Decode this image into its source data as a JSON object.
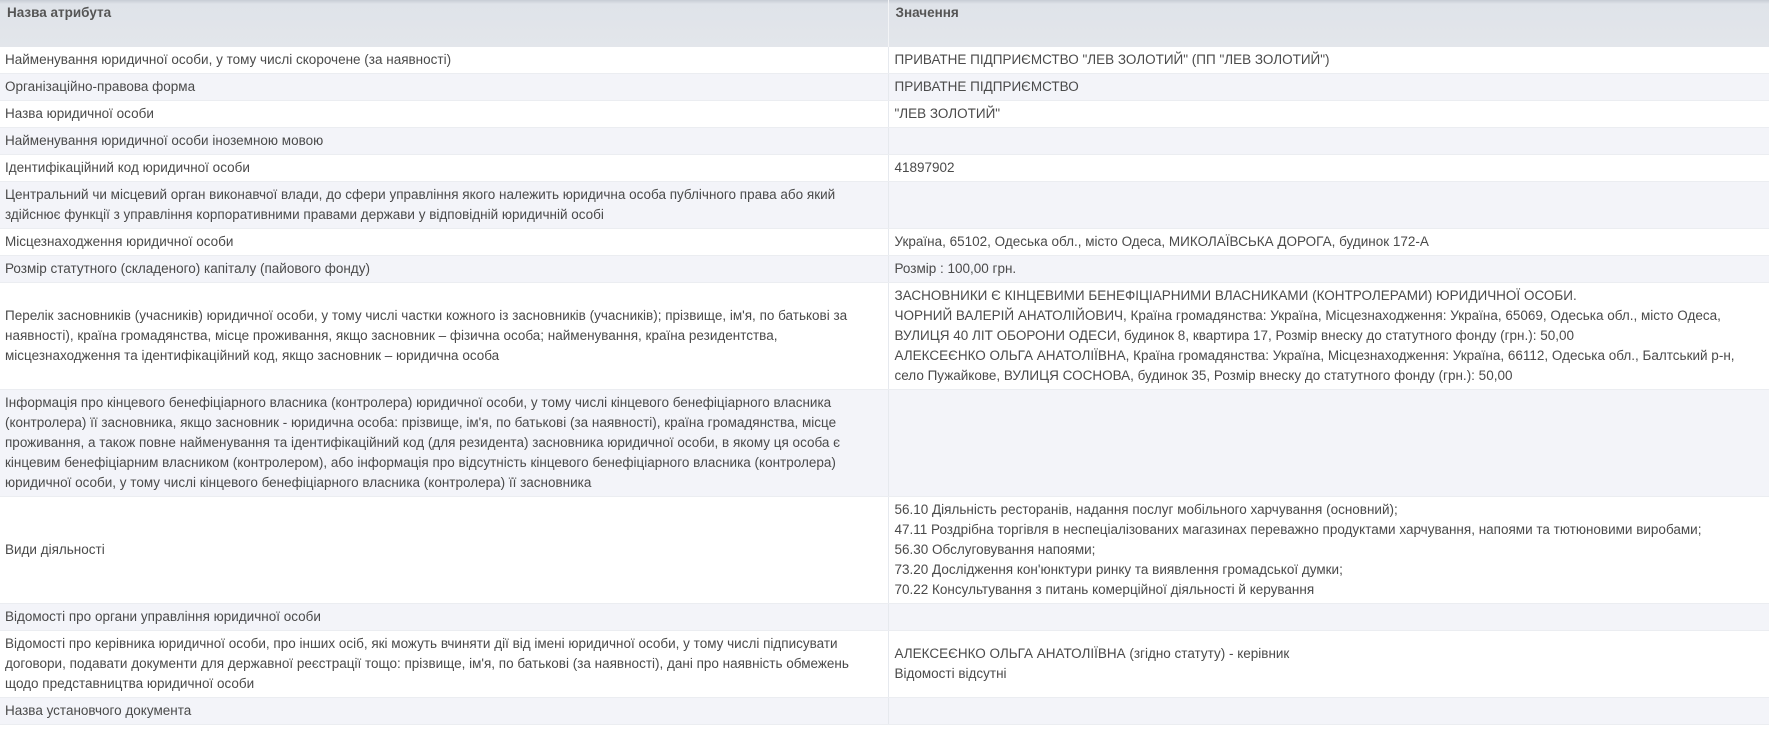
{
  "header": {
    "attr_col": "Назва атрибута",
    "value_col": "Значення"
  },
  "rows": [
    {
      "attr": "Найменування юридичної особи, у тому числі скорочене (за наявності)",
      "value": [
        "ПРИВАТНЕ ПІДПРИЄМСТВО \"ЛЕВ ЗОЛОТИЙ\" (ПП \"ЛЕВ ЗОЛОТИЙ\")"
      ]
    },
    {
      "attr": "Організаційно-правова форма",
      "value": [
        "ПРИВАТНЕ ПІДПРИЄМСТВО"
      ]
    },
    {
      "attr": "Назва юридичної особи",
      "value": [
        "\"ЛЕВ ЗОЛОТИЙ\""
      ]
    },
    {
      "attr": "Найменування юридичної особи іноземною мовою",
      "value": []
    },
    {
      "attr": "Ідентифікаційний код юридичної особи",
      "value": [
        "41897902"
      ]
    },
    {
      "attr": "Центральний чи місцевий орган виконавчої влади, до сфери управління якого належить юридична особа публічного права або який здійснює функції з управління корпоративними правами держави у відповідній юридичній особі",
      "value": []
    },
    {
      "attr": "Місцезнаходження юридичної особи",
      "value": [
        "Україна, 65102, Одеська обл., місто Одеса, МИКОЛАЇВСЬКА ДОРОГА, будинок 172-А"
      ]
    },
    {
      "attr": "Розмір статутного (складеного) капіталу (пайового фонду)",
      "value": [
        "Розмір : 100,00 грн."
      ]
    },
    {
      "attr": "Перелік засновників (учасників) юридичної особи, у тому числі частки кожного із засновників (учасників); прізвище, ім'я, по батькові за наявності), країна громадянства, місце проживання, якщо засновник – фізична особа; найменування, країна резидентства, місцезнаходження та ідентифікаційний код, якщо засновник – юридична особа",
      "value": [
        "ЗАСНОВНИКИ Є КІНЦЕВИМИ БЕНЕФІЦІАРНИМИ ВЛАСНИКАМИ (КОНТРОЛЕРАМИ) ЮРИДИЧНОЇ ОСОБИ.",
        "ЧОРНИЙ ВАЛЕРІЙ АНАТОЛІЙОВИЧ, Країна громадянства: Україна, Місцезнаходження: Україна, 65069, Одеська обл., місто Одеса, ВУЛИЦЯ 40 ЛІТ ОБОРОНИ ОДЕСИ, будинок 8, квартира 17, Розмір внеску до статутного фонду (грн.): 50,00",
        "АЛЕКСЕЄНКО ОЛЬГА АНАТОЛІЇВНА, Країна громадянства: Україна, Місцезнаходження: Україна, 66112, Одеська обл., Балтський р-н, село Пужайкове, ВУЛИЦЯ СОСНОВА, будинок 35, Розмір внеску до статутного фонду (грн.): 50,00"
      ]
    },
    {
      "attr": "Інформація про кінцевого бенефіціарного власника (контролера) юридичної особи, у тому числі кінцевого бенефіціарного власника (контролера) її засновника, якщо засновник - юридична особа: прізвище, ім'я, по батькові (за наявності), країна громадянства, місце проживання, а також повне найменування та ідентифікаційний код (для резидента) засновника юридичної особи, в якому ця особа є кінцевим бенефіціарним власником (контролером), або інформація про відсутність кінцевого бенефіціарного власника (контролера) юридичної особи, у тому числі кінцевого бенефіціарного власника (контролера) її засновника",
      "value": []
    },
    {
      "attr": "Види діяльності",
      "value": [
        "56.10 Діяльність ресторанів, надання послуг мобільного харчування (основний);",
        "47.11 Роздрібна торгівля в неспеціалізованих магазинах переважно продуктами харчування, напоями та тютюновими виробами;",
        "56.30 Обслуговування напоями;",
        "73.20 Дослідження кон'юнктури ринку та виявлення громадської думки;",
        "70.22 Консультування з питань комерційної діяльності й керування"
      ]
    },
    {
      "attr": "Відомості про органи управління юридичної особи",
      "value": []
    },
    {
      "attr": "Відомості про керівника юридичної особи, про інших осіб, які можуть вчиняти дії від імені юридичної особи, у тому числі підписувати договори, подавати документи для державної реєстрації тощо: прізвище, ім'я, по батькові (за наявності), дані про наявність обмежень щодо представництва юридичної особи",
      "value": [
        "АЛЕКСЕЄНКО ОЛЬГА АНАТОЛІЇВНА (згідно статуту) - керівник",
        "Відомості відсутні"
      ]
    },
    {
      "attr": "Назва установчого документа",
      "value": []
    }
  ]
}
